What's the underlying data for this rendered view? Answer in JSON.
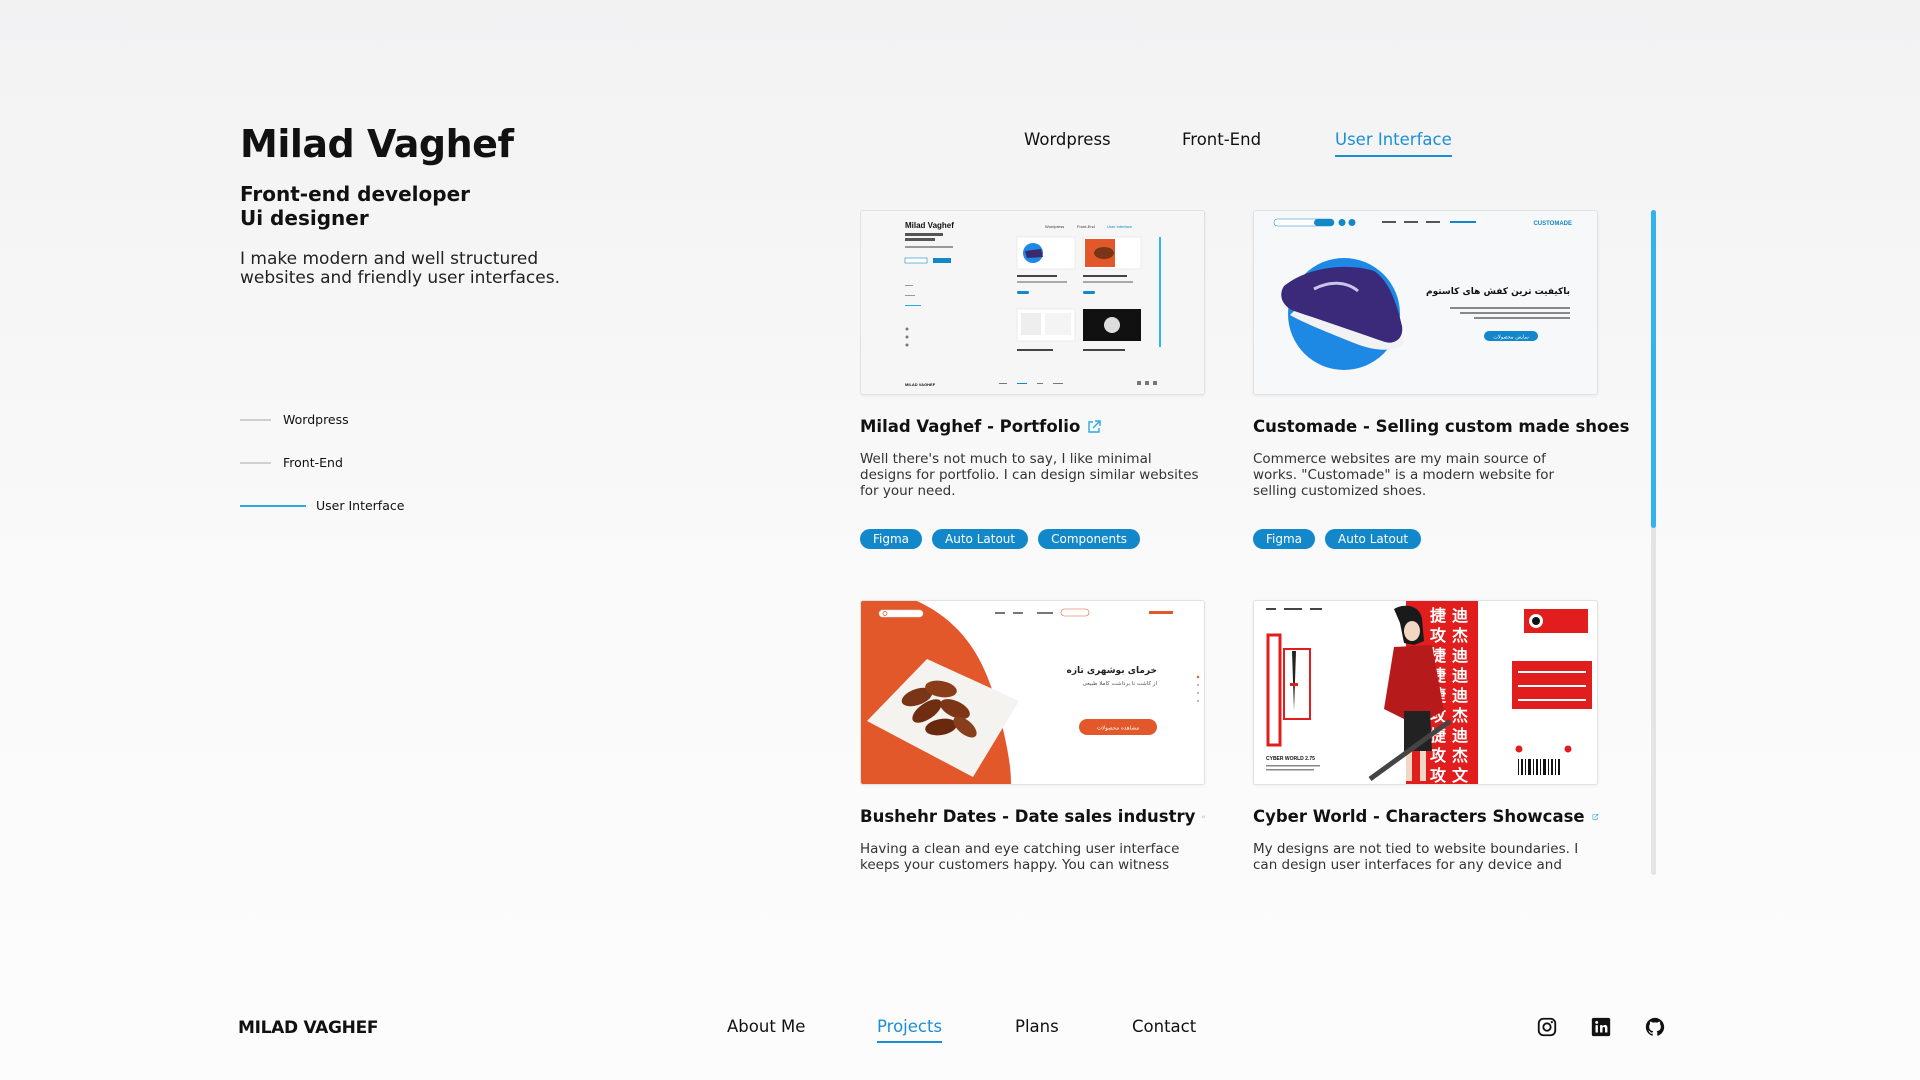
{
  "intro": {
    "name": "Milad Vaghef",
    "roles": [
      "Front-end developer",
      "Ui designer"
    ],
    "bio": "I make modern and well structured websites and friendly user interfaces."
  },
  "side_nav": [
    {
      "label": "Wordpress",
      "active": false
    },
    {
      "label": "Front-End",
      "active": false
    },
    {
      "label": "User Interface",
      "active": true
    }
  ],
  "tabs": [
    {
      "label": "Wordpress",
      "active": false
    },
    {
      "label": "Front-End",
      "active": false
    },
    {
      "label": "User Interface",
      "active": true
    }
  ],
  "projects": [
    {
      "title": "Milad Vaghef - Portfolio",
      "description": "Well there's not much to say, I like minimal designs for portfolio. I can design similar websites for your need.",
      "tags": [
        "Figma",
        "Auto Latout",
        "Components"
      ],
      "thumb": {
        "heading": "Milad Vaghef",
        "brand": "MILAD VAGHEF"
      }
    },
    {
      "title": "Customade - Selling custom made shoes",
      "description": "Commerce websites are my main source of works. \"Customade\" is a modern website for selling customized shoes.",
      "tags": [
        "Figma",
        "Auto Latout"
      ],
      "thumb": {
        "brand": "CUSTOMADE",
        "headline": "باکیفیت ترین کفش های کاستوم",
        "cta": "نمایش محصولات"
      }
    },
    {
      "title": "Bushehr Dates - Date sales industry",
      "description": "Having a clean and eye catching user interface keeps your customers happy. You can witness that",
      "tags": [],
      "thumb": {
        "headline": "خرمای بوشهری تازه",
        "sub": "از کاشت تا برداشت کاملا طبیعی",
        "cta": "مشاهده محصولات"
      }
    },
    {
      "title": "Cyber World - Characters Showcase",
      "description": "My designs are not tied to website boundaries. I can design user interfaces for any device and",
      "tags": [],
      "thumb": {
        "caption": "CYBER WORLD 2.75"
      }
    }
  ],
  "footer": {
    "logo": "MILAD VAGHEF",
    "nav": [
      {
        "label": "About Me",
        "active": false
      },
      {
        "label": "Projects",
        "active": true
      },
      {
        "label": "Plans",
        "active": false
      },
      {
        "label": "Contact",
        "active": false
      }
    ],
    "social": [
      "instagram-icon",
      "linkedin-icon",
      "github-icon"
    ]
  },
  "colors": {
    "accent": "#1b8fd6",
    "tag": "#1287c9",
    "scroll": "#32b2ef",
    "dates_orange": "#e2582b",
    "cyber_red": "#e11d1d"
  }
}
